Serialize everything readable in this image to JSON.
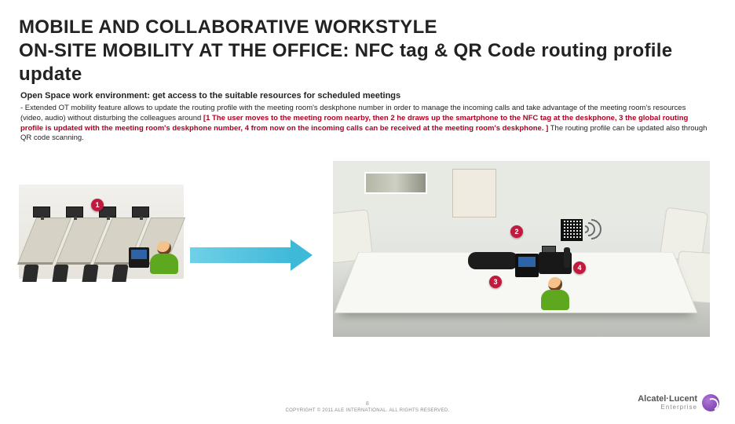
{
  "title_line1": "MOBILE AND COLLABORATIVE WORKSTYLE",
  "title_line2": "ON-SITE MOBILITY AT THE OFFICE: NFC tag & QR Code routing profile update",
  "subhead": "Open Space work environment: get access to the suitable resources for scheduled meetings",
  "body_prefix": "- Extended OT mobility feature allows to update the routing profile with the meeting room's deskphone number in order to manage the incoming calls and take advantage of the meeting room's resources (video, audio) without disturbing the colleagues around ",
  "body_hl": "[1 The user moves to the meeting room nearby, then 2 he draws up the smartphone to the NFC tag at the deskphone, 3 the global routing profile is updated with the meeting room's deskphone number, 4 from now on the incoming calls can be received at the meeting room's deskphone. ]",
  "body_suffix": " The routing profile can be updated also through QR code scanning.",
  "badges": {
    "b1": "1",
    "b2": "2",
    "b3": "3",
    "b4": "4"
  },
  "footer_page": "8",
  "footer_text": "COPYRIGHT © 2011 ALE INTERNATIONAL. ALL RIGHTS RESERVED.",
  "logo": {
    "line1": "Alcatel·Lucent",
    "line2": "Enterprise"
  }
}
